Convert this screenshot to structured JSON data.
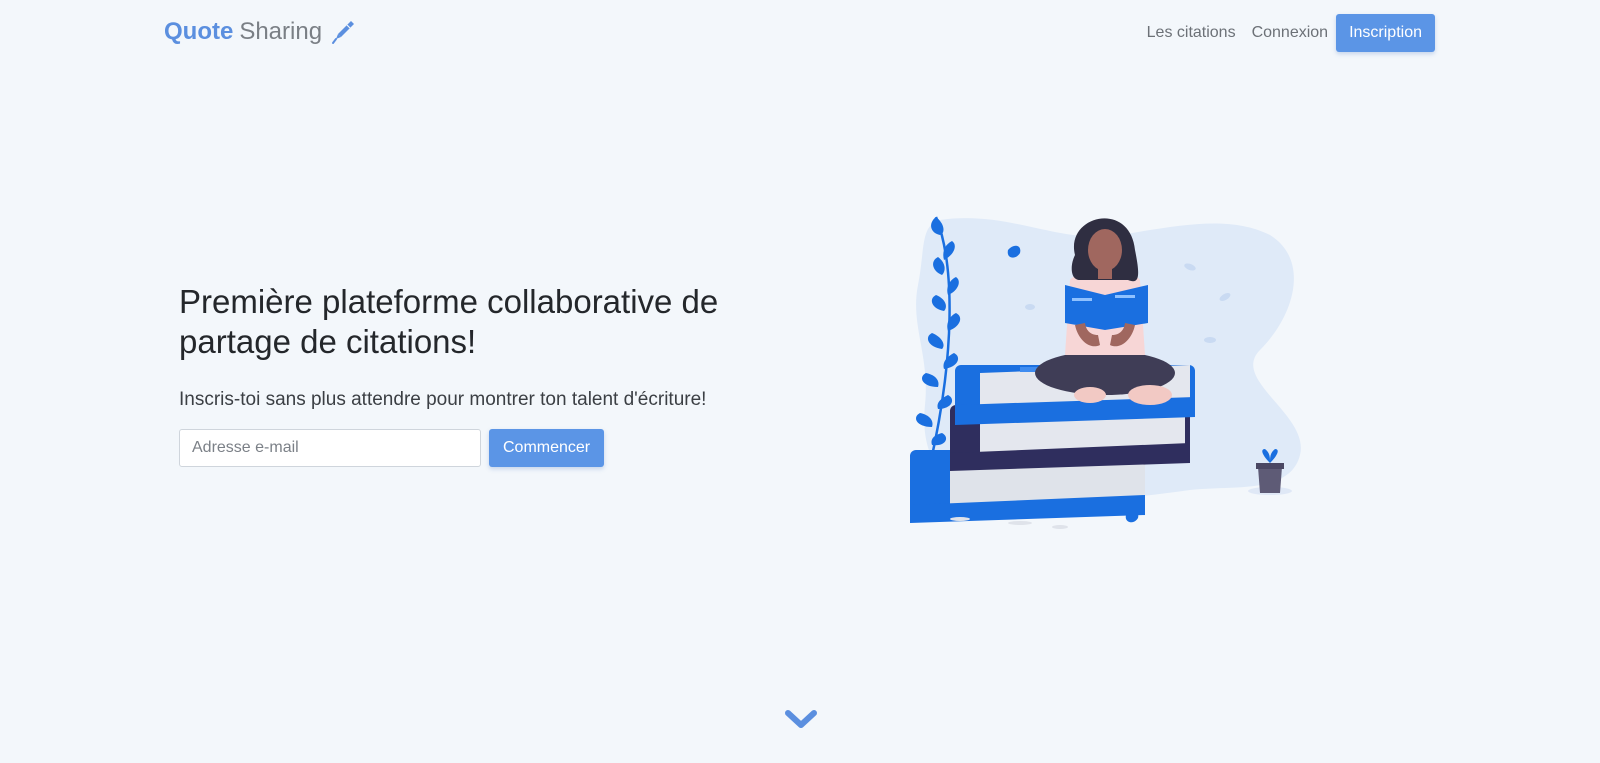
{
  "navbar": {
    "brand_strong": "Quote",
    "brand_light": "Sharing",
    "brand_icon": "pen-icon",
    "links": [
      {
        "label": "Les citations"
      },
      {
        "label": "Connexion"
      }
    ],
    "signup_label": "Inscription"
  },
  "hero": {
    "title": "Première plateforme collaborative de partage de citations!",
    "subtitle": "Inscris-toi sans plus attendre pour montrer ton talent d'écriture!",
    "email_placeholder": "Adresse e-mail",
    "email_value": "",
    "start_label": "Commencer"
  },
  "illustration": {
    "icon": "woman-reading-on-books-illustration"
  },
  "scroll": {
    "icon": "chevron-down-icon"
  },
  "colors": {
    "background": "#f3f7fb",
    "accent": "#5b95e6",
    "brand": "#5b8fdf",
    "book_blue": "#1a6fe0",
    "book_navy": "#2f2e5e"
  }
}
